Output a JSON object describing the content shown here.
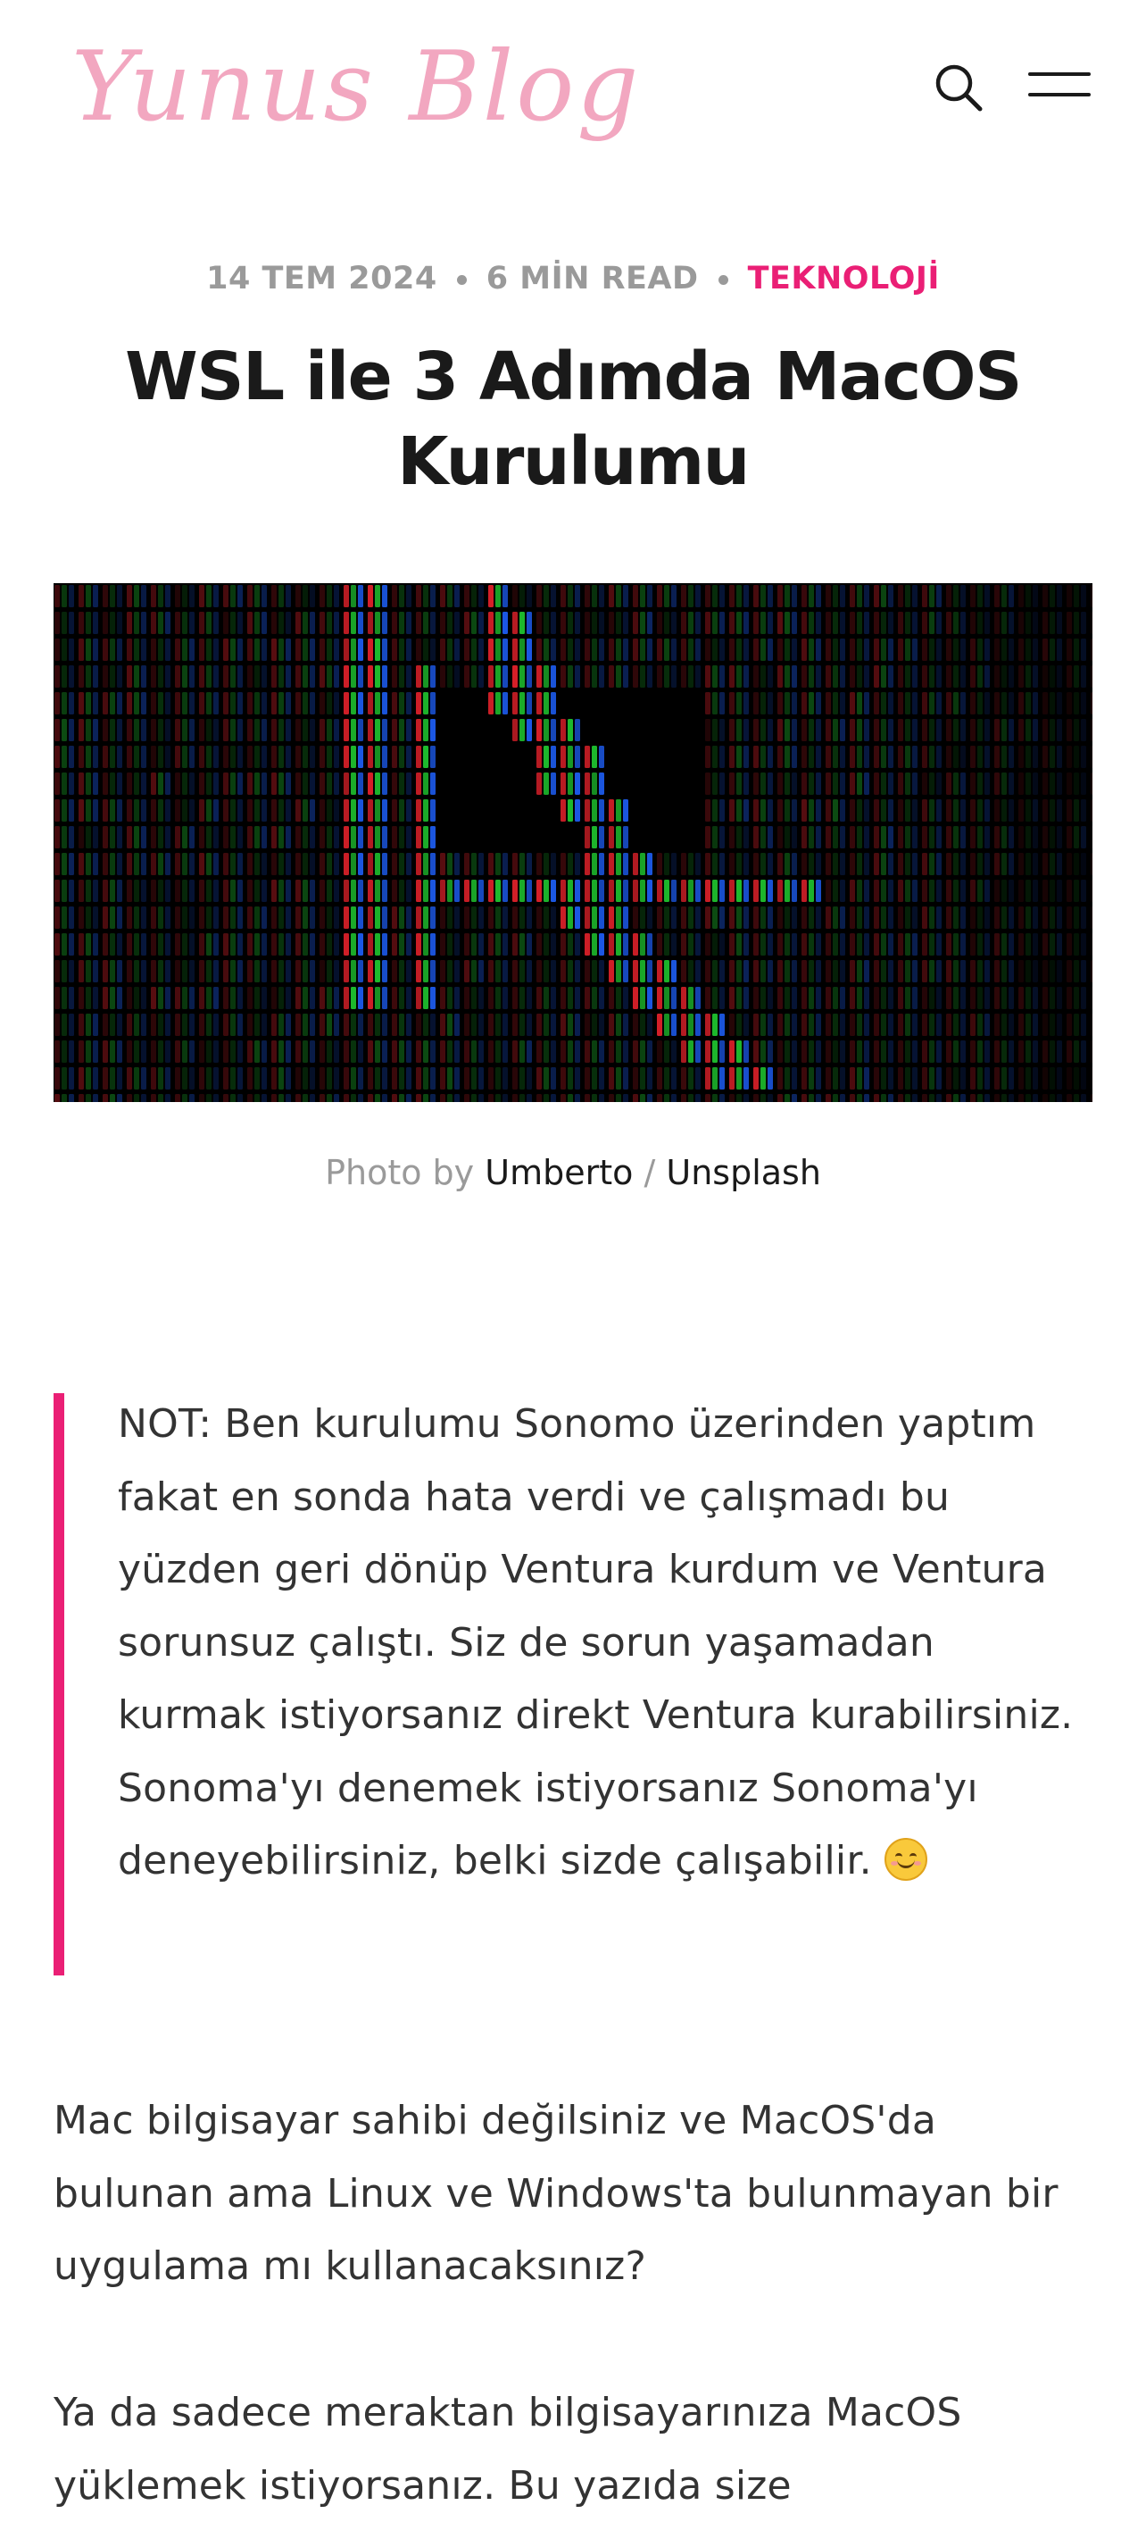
{
  "header": {
    "logo_text": "Yunus Blog",
    "search_icon": "search-icon",
    "menu_icon": "menu-icon",
    "logo_color": "#f2a7c0"
  },
  "post": {
    "date": "14 TEM 2024",
    "read_time": "6 MİN READ",
    "category": "TEKNOLOJİ",
    "category_color": "#ea1f75",
    "title": "WSL ile 3 Adımda MacOS Kurulumu"
  },
  "hero": {
    "caption_prefix": "Photo by",
    "author": "Umberto",
    "separator": "/",
    "source": "Unsplash"
  },
  "content": {
    "note": "NOT: Ben kurulumu Sonomo üzerinden yaptım fakat en sonda hata verdi ve çalışmadı bu yüzden geri dönüp Ventura kurdum ve Ventura sorunsuz çalıştı. Siz de sorun yaşamadan kurmak istiyorsanız direkt Ventura kurabilirsiniz. Sonoma'yı denemek istiyorsanız Sonoma'yı deneyebilirsiniz, belki sizde çalışabilir.",
    "note_emoji": "smiling-face-icon",
    "paragraph_1": "Mac bilgisayar sahibi değilsiniz ve MacOS'da bulunan ama Linux ve Windows'ta bulunmayan bir uygulama mı kullanacaksınız?",
    "paragraph_2": "Ya da sadece meraktan bilgisayarınıza MacOS yüklemek istiyorsanız. Bu yazıda size"
  },
  "colors": {
    "accent": "#ea1f75",
    "muted": "#9a9a9a",
    "text": "#333333"
  }
}
